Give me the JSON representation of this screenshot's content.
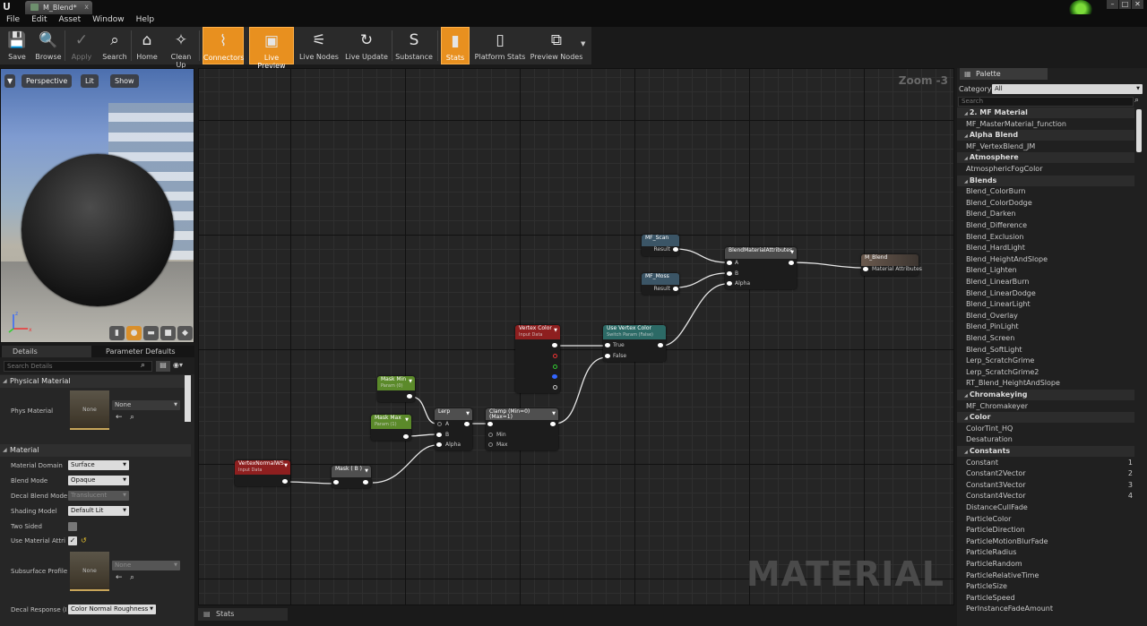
{
  "window": {
    "doc_tab": "M_Blend*",
    "close_glyph": "x",
    "logo_glyph": "U",
    "controls": [
      "–",
      "□",
      "✕"
    ]
  },
  "menu": [
    "File",
    "Edit",
    "Asset",
    "Window",
    "Help"
  ],
  "toolbar": [
    {
      "label": "Save",
      "icon": "save-icon",
      "glyph": "💾",
      "state": "normal"
    },
    {
      "label": "Browse",
      "icon": "browse-icon",
      "glyph": "🔍",
      "state": "normal"
    },
    {
      "label": "Apply",
      "icon": "apply-check-icon",
      "glyph": "✓",
      "state": "disabled"
    },
    {
      "label": "Search",
      "icon": "binoculars-icon",
      "glyph": "⌕",
      "state": "normal"
    },
    {
      "label": "Home",
      "icon": "home-icon",
      "glyph": "⌂",
      "state": "normal"
    },
    {
      "label": "Clean Up",
      "icon": "broom-icon",
      "glyph": "✧",
      "state": "normal"
    },
    {
      "label": "Connectors",
      "icon": "connectors-icon",
      "glyph": "⌇",
      "state": "active"
    },
    {
      "label": "Live Preview",
      "icon": "tv-check-icon",
      "glyph": "▣",
      "state": "active"
    },
    {
      "label": "Live Nodes",
      "icon": "live-nodes-icon",
      "glyph": "⚟",
      "state": "normal"
    },
    {
      "label": "Live Update",
      "icon": "refresh-icon",
      "glyph": "↻",
      "state": "normal"
    },
    {
      "label": "Substance",
      "icon": "substance-icon",
      "glyph": "S",
      "state": "normal"
    },
    {
      "label": "Stats",
      "icon": "stats-icon",
      "glyph": "▮",
      "state": "active"
    },
    {
      "label": "Platform Stats",
      "icon": "platform-stats-icon",
      "glyph": "▯",
      "state": "normal"
    },
    {
      "label": "Preview Nodes",
      "icon": "preview-nodes-icon",
      "glyph": "⧉",
      "state": "normal"
    }
  ],
  "viewport": {
    "menu_glyph": "▼",
    "perspective": "Perspective",
    "lit": "Lit",
    "show": "Show",
    "bottom_icons": [
      "cylinder-icon",
      "sphere-icon",
      "plane-icon",
      "cube-icon",
      "mesh-icon"
    ],
    "bottom_glyphs": [
      "▮",
      "●",
      "▬",
      "■",
      "◆"
    ],
    "axes": {
      "x": "x",
      "y": "",
      "z": "z"
    }
  },
  "details": {
    "tab_details": "Details",
    "tab_params": "Parameter Defaults",
    "search_placeholder": "Search Details",
    "section_physical": "Physical Material",
    "phys_material_label": "Phys Material",
    "phys_material_thumb": "None",
    "phys_material_value": "None",
    "section_material": "Material",
    "rows": [
      {
        "label": "Material Domain",
        "value": "Surface"
      },
      {
        "label": "Blend Mode",
        "value": "Opaque"
      },
      {
        "label": "Decal Blend Mode",
        "value": "Translucent"
      },
      {
        "label": "Shading Model",
        "value": "Default Lit"
      }
    ],
    "two_sided": "Two Sided",
    "use_material_attr": "Use Material Attri",
    "subsurface_label": "Subsurface Profile",
    "subsurface_thumb": "None",
    "subsurface_value": "None",
    "decal_response_label": "Decal Response (I",
    "decal_response_value": "Color Normal Roughness"
  },
  "graph": {
    "zoom": "Zoom -3",
    "watermark": "MATERIAL",
    "stats_tab": "Stats",
    "nodes": {
      "mf_scan": {
        "title": "MF_Scan",
        "out": "Result"
      },
      "mf_moss": {
        "title": "MF_Moss",
        "out": "Result"
      },
      "blend_attr": {
        "title": "BlendMaterialAttributes",
        "pins": [
          "A",
          "B",
          "Alpha"
        ]
      },
      "m_blend": {
        "title": "M_Blend",
        "pin": "Material Attributes"
      },
      "vertex_color": {
        "title": "Vertex Color",
        "sub": "Input Data"
      },
      "use_vertex_color": {
        "title": "Use Vertex Color",
        "sub": "Switch Param (False)",
        "pins": [
          "True",
          "False"
        ]
      },
      "mask_min": {
        "title": "Mask Min",
        "sub": "Param (0)"
      },
      "mask_max": {
        "title": "Mask Max",
        "sub": "Param (1)"
      },
      "lerp": {
        "title": "Lerp",
        "pins": [
          "A",
          "B",
          "Alpha"
        ]
      },
      "clamp": {
        "title": "Clamp (Min=0) (Max=1)",
        "pins": [
          "Min",
          "Max"
        ]
      },
      "vertex_normal": {
        "title": "VertexNormalWS",
        "sub": "Input Data"
      },
      "mask_b": {
        "title": "Mask ( B )"
      }
    }
  },
  "palette": {
    "tab": "Palette",
    "category_label": "Category:",
    "category_value": "All",
    "search_placeholder": "Search",
    "items": [
      {
        "t": "2. MF Material",
        "cat": true
      },
      {
        "t": "MF_MasterMaterial_function"
      },
      {
        "t": "Alpha Blend",
        "cat": true
      },
      {
        "t": "MF_VertexBlend_JM"
      },
      {
        "t": "Atmosphere",
        "cat": true
      },
      {
        "t": "AtmosphericFogColor"
      },
      {
        "t": "Blends",
        "cat": true
      },
      {
        "t": "Blend_ColorBurn"
      },
      {
        "t": "Blend_ColorDodge"
      },
      {
        "t": "Blend_Darken"
      },
      {
        "t": "Blend_Difference"
      },
      {
        "t": "Blend_Exclusion"
      },
      {
        "t": "Blend_HardLight"
      },
      {
        "t": "Blend_HeightAndSlope"
      },
      {
        "t": "Blend_Lighten"
      },
      {
        "t": "Blend_LinearBurn"
      },
      {
        "t": "Blend_LinearDodge"
      },
      {
        "t": "Blend_LinearLight"
      },
      {
        "t": "Blend_Overlay"
      },
      {
        "t": "Blend_PinLight"
      },
      {
        "t": "Blend_Screen"
      },
      {
        "t": "Blend_SoftLight"
      },
      {
        "t": "Lerp_ScratchGrime"
      },
      {
        "t": "Lerp_ScratchGrime2"
      },
      {
        "t": "RT_Blend_HeightAndSlope"
      },
      {
        "t": "Chromakeying",
        "cat": true
      },
      {
        "t": "MF_Chromakeyer"
      },
      {
        "t": "Color",
        "cat": true
      },
      {
        "t": "ColorTint_HQ"
      },
      {
        "t": "Desaturation"
      },
      {
        "t": "Constants",
        "cat": true
      },
      {
        "t": "Constant",
        "hk": "1"
      },
      {
        "t": "Constant2Vector",
        "hk": "2"
      },
      {
        "t": "Constant3Vector",
        "hk": "3"
      },
      {
        "t": "Constant4Vector",
        "hk": "4"
      },
      {
        "t": "DistanceCullFade"
      },
      {
        "t": "ParticleColor"
      },
      {
        "t": "ParticleDirection"
      },
      {
        "t": "ParticleMotionBlurFade"
      },
      {
        "t": "ParticleRadius"
      },
      {
        "t": "ParticleRandom"
      },
      {
        "t": "ParticleRelativeTime"
      },
      {
        "t": "ParticleSize"
      },
      {
        "t": "ParticleSpeed"
      },
      {
        "t": "PerInstanceFadeAmount"
      }
    ]
  },
  "colors": {
    "accent_orange": "#e8901f",
    "node_blue": "#3b5566",
    "node_green": "#5b8a2a",
    "node_red": "#8e1f1f",
    "node_teal": "#2c6a66",
    "node_gray": "#4f4f4f"
  }
}
